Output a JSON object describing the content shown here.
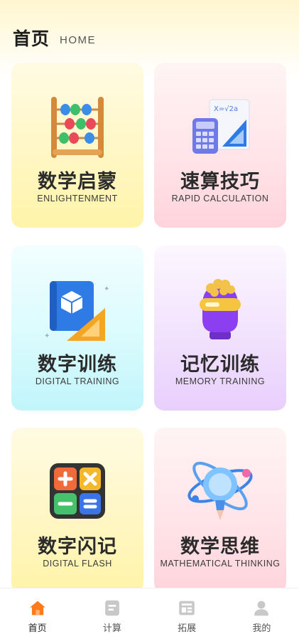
{
  "header": {
    "title": "首页",
    "subtitle": "HOME"
  },
  "cards": [
    {
      "cn": "数学启蒙",
      "en": "ENLIGHTENMENT",
      "icon": "abacus-icon",
      "color": "#fff4a8"
    },
    {
      "cn": "速算技巧",
      "en": "RAPID CALCULATION",
      "icon": "calculator-ruler-icon",
      "color": "#ffd3dc"
    },
    {
      "cn": "数字训练",
      "en": "DIGITAL TRAINING",
      "icon": "blueprint-cube-icon",
      "color": "#c1f5fb"
    },
    {
      "cn": "记忆训练",
      "en": "MEMORY TRAINING",
      "icon": "brain-headset-icon",
      "color": "#e8cffd"
    },
    {
      "cn": "数字闪记",
      "en": "DIGITAL FLASH",
      "icon": "calculator-keys-icon",
      "color": "#fff4a8"
    },
    {
      "cn": "数学思维",
      "en": "MATHEMATICAL THINKING",
      "icon": "lightbulb-atom-icon",
      "color": "#ffd3dc"
    }
  ],
  "tabbar": [
    {
      "label": "首页",
      "icon": "home-icon",
      "active": true,
      "color": "#ff7a1a"
    },
    {
      "label": "计算",
      "icon": "document-icon",
      "active": false,
      "color": "#c8c8c8"
    },
    {
      "label": "拓展",
      "icon": "news-icon",
      "active": false,
      "color": "#c8c8c8"
    },
    {
      "label": "我的",
      "icon": "person-icon",
      "active": false,
      "color": "#c8c8c8"
    }
  ]
}
